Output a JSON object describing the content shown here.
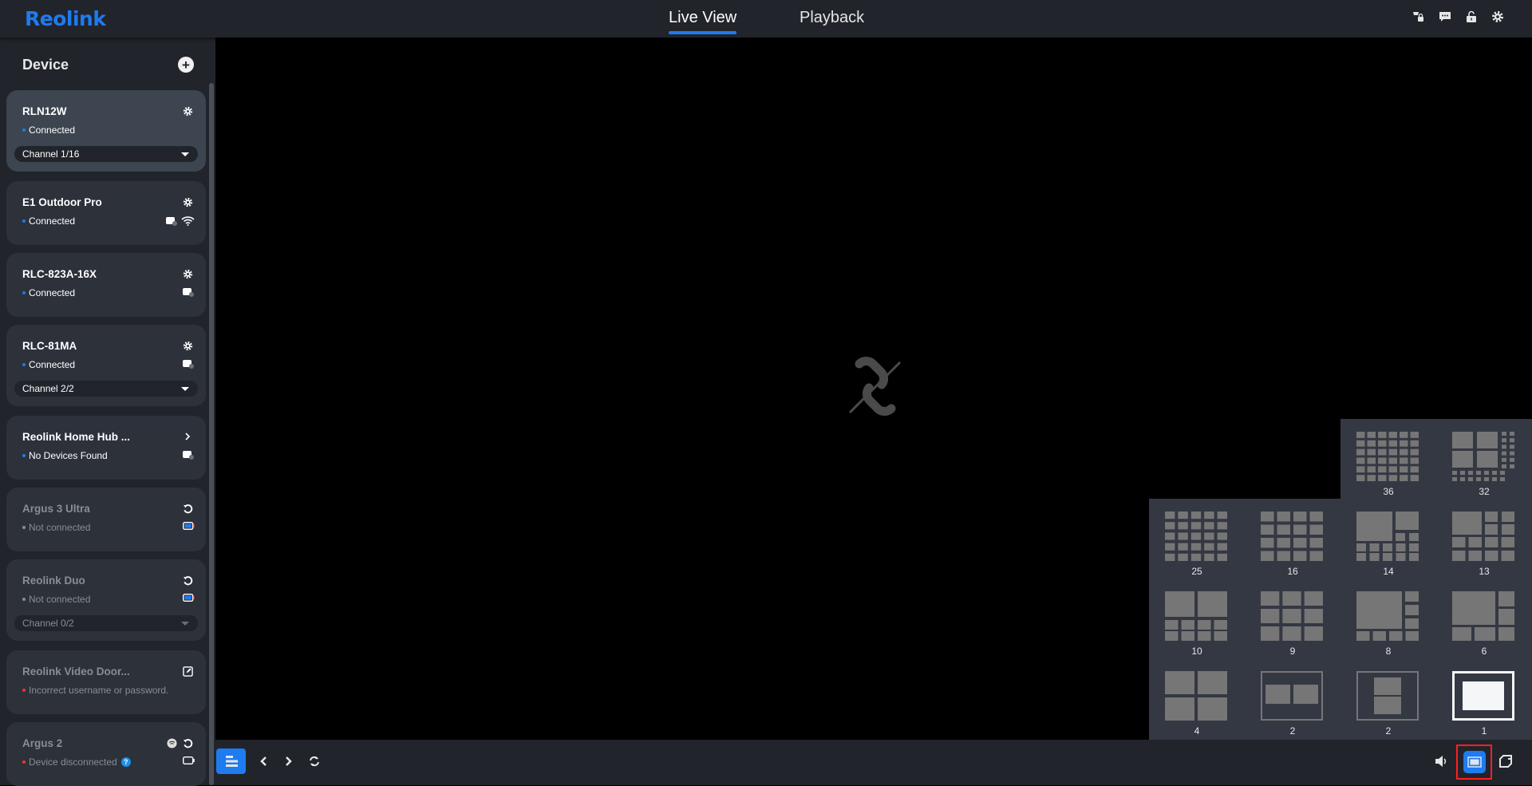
{
  "header": {
    "logo": "Reolink",
    "tabs": [
      {
        "label": "Live View",
        "active": true
      },
      {
        "label": "Playback",
        "active": false
      }
    ],
    "icons": [
      "translate-lock-icon",
      "message-icon",
      "unlock-icon",
      "settings-gear-icon"
    ]
  },
  "sidebar": {
    "title": "Device",
    "add_icon": "plus-circle-icon",
    "devices": [
      {
        "name": "RLN12W",
        "status": "Connected",
        "status_color": "#1e7bf0",
        "action_icon": "gear-icon",
        "channel": "Channel 1/16",
        "selected": true
      },
      {
        "name": "E1 Outdoor Pro",
        "status": "Connected",
        "status_color": "#1e7bf0",
        "action_icon": "gear-icon",
        "status_icons": [
          "storage-icon",
          "wifi-icon"
        ]
      },
      {
        "name": "RLC-823A-16X",
        "status": "Connected",
        "status_color": "#1e7bf0",
        "action_icon": "gear-icon",
        "status_icons": [
          "storage-icon"
        ]
      },
      {
        "name": "RLC-81MA",
        "status": "Connected",
        "status_color": "#1e7bf0",
        "action_icon": "gear-icon",
        "status_icons": [
          "storage-icon"
        ],
        "channel": "Channel 2/2"
      },
      {
        "name": "Reolink Home Hub ...",
        "status": "No Devices Found",
        "status_color": "#1e7bf0",
        "action_icon": "chevron-right-icon",
        "status_icons": [
          "storage-icon"
        ]
      },
      {
        "name": "Argus 3 Ultra",
        "status": "Not connected",
        "status_color": "#8a8d92",
        "action_icon": "refresh-icon",
        "status_icons": [
          "battery-icon"
        ]
      },
      {
        "name": "Reolink Duo",
        "status": "Not connected",
        "status_color": "#8a8d92",
        "action_icon": "refresh-icon",
        "status_icons": [
          "battery-icon"
        ],
        "channel": "Channel 0/2"
      },
      {
        "name": "Reolink Video Door...",
        "status": "Incorrect username or password.",
        "status_color": "#ff3030",
        "action_icon": "edit-icon"
      },
      {
        "name": "Argus 2",
        "status": "Device disconnected",
        "status_color": "#ff3030",
        "action_icon": "refresh-icon",
        "extra_icon": "wifi-badge-icon",
        "help_icon": "?",
        "status_icons": [
          "battery-empty-icon"
        ]
      }
    ]
  },
  "video": {
    "placeholder_icon": "broken-link-icon"
  },
  "layout_picker": {
    "options": [
      {
        "label": "36"
      },
      {
        "label": "32"
      },
      {
        "label": "25"
      },
      {
        "label": "16"
      },
      {
        "label": "14"
      },
      {
        "label": "13"
      },
      {
        "label": "10"
      },
      {
        "label": "9"
      },
      {
        "label": "8"
      },
      {
        "label": "6"
      },
      {
        "label": "4"
      },
      {
        "label": "2"
      },
      {
        "label": "2"
      },
      {
        "label": "1",
        "selected": true
      }
    ]
  },
  "bottombar": {
    "left": [
      "device-list-toggle-icon",
      "previous-icon",
      "next-icon",
      "rotate-icon"
    ],
    "right": [
      "volume-icon",
      "screen-layout-icon",
      "fullscreen-icon"
    ]
  },
  "colors": {
    "accent": "#1e7bf0",
    "panel": "#343843",
    "bar": "#21242b",
    "highlight_border": "#ff2020"
  }
}
